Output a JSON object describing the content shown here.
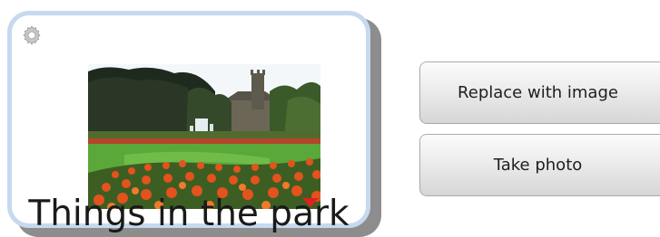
{
  "card": {
    "title": "Things in the park",
    "settings_icon": "gear-icon",
    "photo_menu_icon": "triangle-down-icon"
  },
  "actions": {
    "replace_label": "Replace with image",
    "take_photo_label": "Take photo"
  },
  "colors": {
    "card_border": "#c6d9ee",
    "card_shadow": "#8d8d8d",
    "menu_triangle": "#e02020"
  }
}
